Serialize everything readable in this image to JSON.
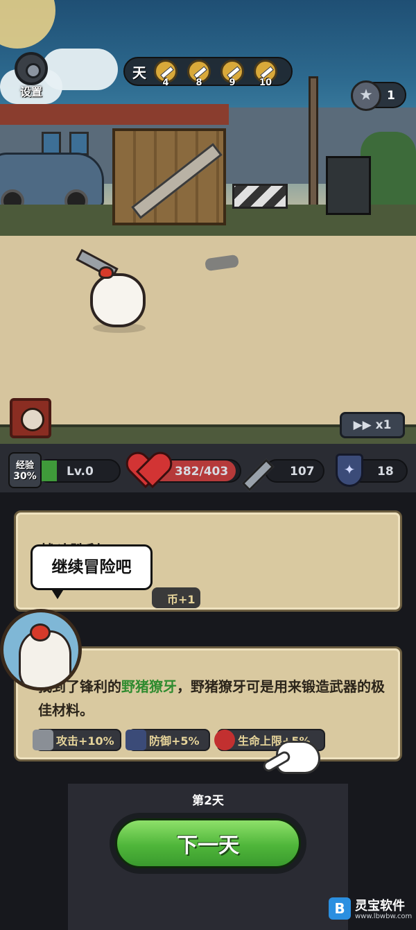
{
  "hud": {
    "settings_label": "设置",
    "days_label": "天",
    "milestones": [
      "4",
      "8",
      "9",
      "10"
    ],
    "coin_count": "1",
    "speed_label": "▶▶ x1"
  },
  "stats": {
    "exp_label": "经验",
    "exp_percent": "30%",
    "level": "Lv.0",
    "hp": "382/403",
    "hp_fraction": 0.948,
    "attack": "107",
    "defense": "18"
  },
  "card1": {
    "title": "战斗胜利",
    "reward": "币+1"
  },
  "card2": {
    "text_prefix": "找到了锋利的",
    "item_name": "野猪獠牙",
    "text_suffix": "，野猪獠牙可是用来锻造武器的极佳材料。",
    "tags": [
      "攻击+10%",
      "防御+5%",
      "生命上限+5%"
    ]
  },
  "speech": "继续冒险吧",
  "footer": {
    "day_label": "第2天",
    "next_button": "下一天"
  },
  "watermark": {
    "title": "灵宝软件",
    "url": "www.lbwbw.com"
  },
  "colors": {
    "green_button": "#4fb63a",
    "item_highlight": "#2f8b2f",
    "card_bg": "#d9c9a0"
  }
}
